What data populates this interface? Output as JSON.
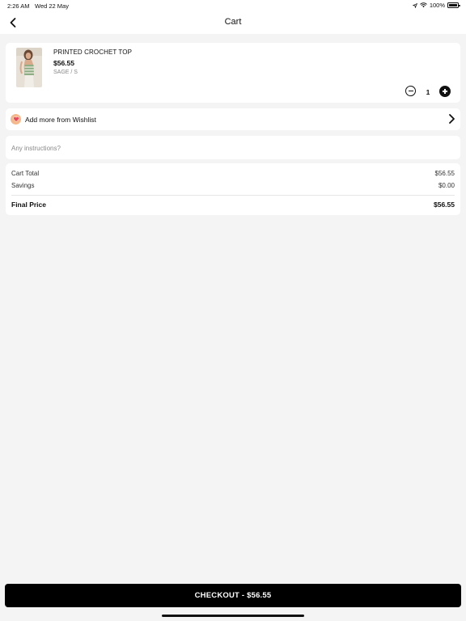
{
  "status_bar": {
    "time": "2:26 AM",
    "date": "Wed 22 May",
    "battery": "100%",
    "icons": [
      "location-icon",
      "wifi-icon",
      "battery-icon"
    ]
  },
  "nav": {
    "title": "Cart",
    "back_icon": "chevron-left-icon"
  },
  "cart": {
    "items": [
      {
        "name": "PRINTED CROCHET TOP",
        "price": "$56.55",
        "variant": "SAGE / S",
        "quantity": "1",
        "image": "product-thumbnail"
      }
    ]
  },
  "wishlist": {
    "label": "Add more from Wishlist",
    "icon": "heart-icon",
    "icon_color": "#f5b88a"
  },
  "instructions": {
    "placeholder": "Any instructions?",
    "value": ""
  },
  "summary": {
    "cart_total_label": "Cart Total",
    "cart_total_value": "$56.55",
    "savings_label": "Savings",
    "savings_value": "$0.00",
    "final_label": "Final Price",
    "final_value": "$56.55"
  },
  "checkout": {
    "label": "CHECKOUT - $56.55"
  },
  "colors": {
    "background": "#f4f4f4",
    "card": "#ffffff",
    "primary": "#000000"
  }
}
